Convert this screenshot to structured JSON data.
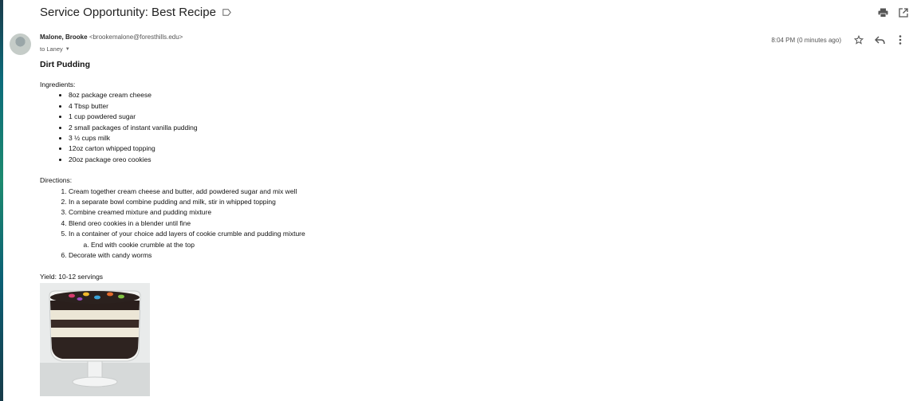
{
  "email": {
    "subject": "Service Opportunity: Best Recipe",
    "sender_name": "Malone, Brooke",
    "sender_email": "<brookemalone@foresthills.edu>",
    "to_label": "to Laney",
    "timestamp": "8:04 PM (0 minutes ago)"
  },
  "icons": {
    "label": "label-icon",
    "print": "print-icon",
    "open_new_window": "open-in-new-window-icon",
    "star": "star-icon",
    "reply": "reply-icon",
    "more": "more-vert-icon",
    "dropdown": "chevron-down-icon"
  },
  "recipe": {
    "title": "Dirt Pudding",
    "ingredients_label": "Ingredients:",
    "ingredients": [
      "8oz package cream cheese",
      "4 Tbsp butter",
      "1 cup powdered sugar",
      "2 small packages of instant vanilla pudding",
      "3 ½ cups milk",
      "12oz carton whipped topping",
      "20oz package oreo cookies"
    ],
    "directions_label": "Directions:",
    "directions": [
      "Cream together cream cheese and butter, add powdered sugar and mix well",
      "In a separate bowl combine pudding and milk, stir in whipped topping",
      "Combine creamed mixture and pudding mixture",
      "Blend oreo cookies in a blender until fine",
      "In a container of your choice add layers of cookie crumble and pudding mixture",
      "Decorate with candy worms"
    ],
    "direction_5_sub": "End with cookie crumble at the top",
    "yield": "Yield: 10-12 servings"
  }
}
